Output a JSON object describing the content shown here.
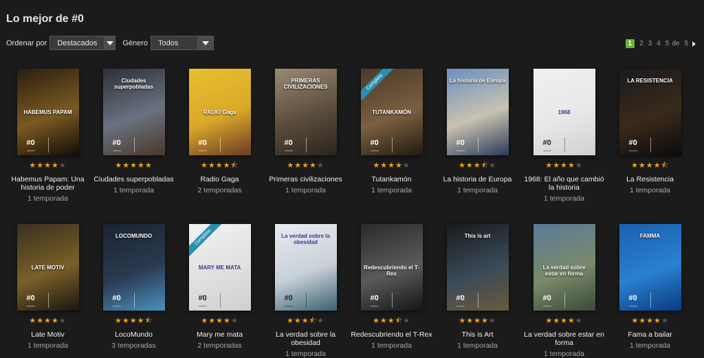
{
  "page": {
    "title": "Lo mejor de #0"
  },
  "filters": {
    "order_label": "Ordenar por",
    "order_value": "Destacados",
    "genre_label": "Género",
    "genre_value": "Todos"
  },
  "pagination": {
    "pages": [
      "1",
      "2",
      "3",
      "4",
      "5"
    ],
    "current": "1",
    "of_text": "de",
    "total": "5"
  },
  "logo_text": "#0",
  "row1": [
    {
      "title": "Habemus Papam: Una historia de poder",
      "seasons": "1 temporada",
      "rating": 4,
      "poster_text": "HABEMUS PAPAM",
      "colors": [
        "#2a1e10",
        "#7a5a22",
        "#120c06"
      ]
    },
    {
      "title": "Ciudades superpobladas",
      "seasons": "1 temporada",
      "rating": 5,
      "poster_text": "Ciudades superpobladas",
      "colors": [
        "#2b3038",
        "#6a7180",
        "#4a3828"
      ]
    },
    {
      "title": "Radio Gaga",
      "seasons": "2 temporadas",
      "rating": 4.5,
      "poster_text": "RADIO Gaga",
      "colors": [
        "#e8c030",
        "#d9a828",
        "#6a3a24"
      ]
    },
    {
      "title": "Primeras civilizaciones",
      "seasons": "1 temporada",
      "rating": 4,
      "poster_text": "PRIMERAS CIVILIZACIONES",
      "colors": [
        "#9a8a74",
        "#5a4c3c",
        "#2a241c"
      ]
    },
    {
      "title": "Tutankamón",
      "seasons": "1 temporada",
      "rating": 4,
      "poster_text": "TUTANKAMÓN",
      "colors": [
        "#4a3a28",
        "#7a6040",
        "#221a10"
      ],
      "ribbon": "Completa"
    },
    {
      "title": "La historia de Europa",
      "seasons": "1 temporada",
      "rating": 3.5,
      "poster_text": "La historia de Europa",
      "colors": [
        "#6a90c0",
        "#c8c2b0",
        "#2a3a5a"
      ]
    },
    {
      "title": "1968: El año que cambió la historia",
      "seasons": "1 temporada",
      "rating": 4,
      "poster_text": "1968",
      "colors": [
        "#f0f0f0",
        "#e8e8e8",
        "#d0d0d0"
      ]
    },
    {
      "title": "La Resistencia",
      "seasons": "1 temporada",
      "rating": 4.5,
      "poster_text": "LA RESISTENCIA",
      "colors": [
        "#1a1a1e",
        "#3a2a1a",
        "#0a0a0c"
      ]
    }
  ],
  "row2": [
    {
      "title": "Late Motiv",
      "seasons": "1 temporada",
      "rating": 4,
      "poster_text": "LATE MOTIV",
      "colors": [
        "#3a3020",
        "#7a6028",
        "#1a1610"
      ]
    },
    {
      "title": "LocoMundo",
      "seasons": "3 temporadas",
      "rating": 4.5,
      "poster_text": "LOCOMUNDO",
      "colors": [
        "#1a2430",
        "#2a3a50",
        "#4a90c0"
      ]
    },
    {
      "title": "Mary me mata",
      "seasons": "2 temporadas",
      "rating": 4,
      "poster_text": "MARY ME MATA",
      "colors": [
        "#f2f2f2",
        "#e0e0e0",
        "#d0d0d0"
      ],
      "ribbon": "Completa"
    },
    {
      "title": "La verdad sobre la obesidad",
      "seasons": "1 temporada",
      "rating": 3.5,
      "poster_text": "La verdad sobre la obesidad",
      "colors": [
        "#e8ecf0",
        "#c8d0d8",
        "#3a6070"
      ]
    },
    {
      "title": "Redescubriendo el T-Rex",
      "seasons": "1 temporada",
      "rating": 3.5,
      "poster_text": "Redescubriendo el T-Rex",
      "colors": [
        "#2a2a2a",
        "#5a5a58",
        "#151515"
      ]
    },
    {
      "title": "This is Art",
      "seasons": "1 temporada",
      "rating": 4,
      "poster_text": "This is art",
      "colors": [
        "#1a1a1a",
        "#3a4a5a",
        "#6a5a3a"
      ]
    },
    {
      "title": "La verdad sobre estar en forma",
      "seasons": "1 temporada",
      "rating": 4,
      "poster_text": "La verdad sobre estar en forma",
      "colors": [
        "#5a7a9a",
        "#7a8a6a",
        "#3a4a3a"
      ]
    },
    {
      "title": "Fama a bailar",
      "seasons": "1 temporada",
      "rating": 4,
      "poster_text": "FAMMA",
      "colors": [
        "#1a60b0",
        "#2a80d0",
        "#0a3a80"
      ]
    }
  ]
}
